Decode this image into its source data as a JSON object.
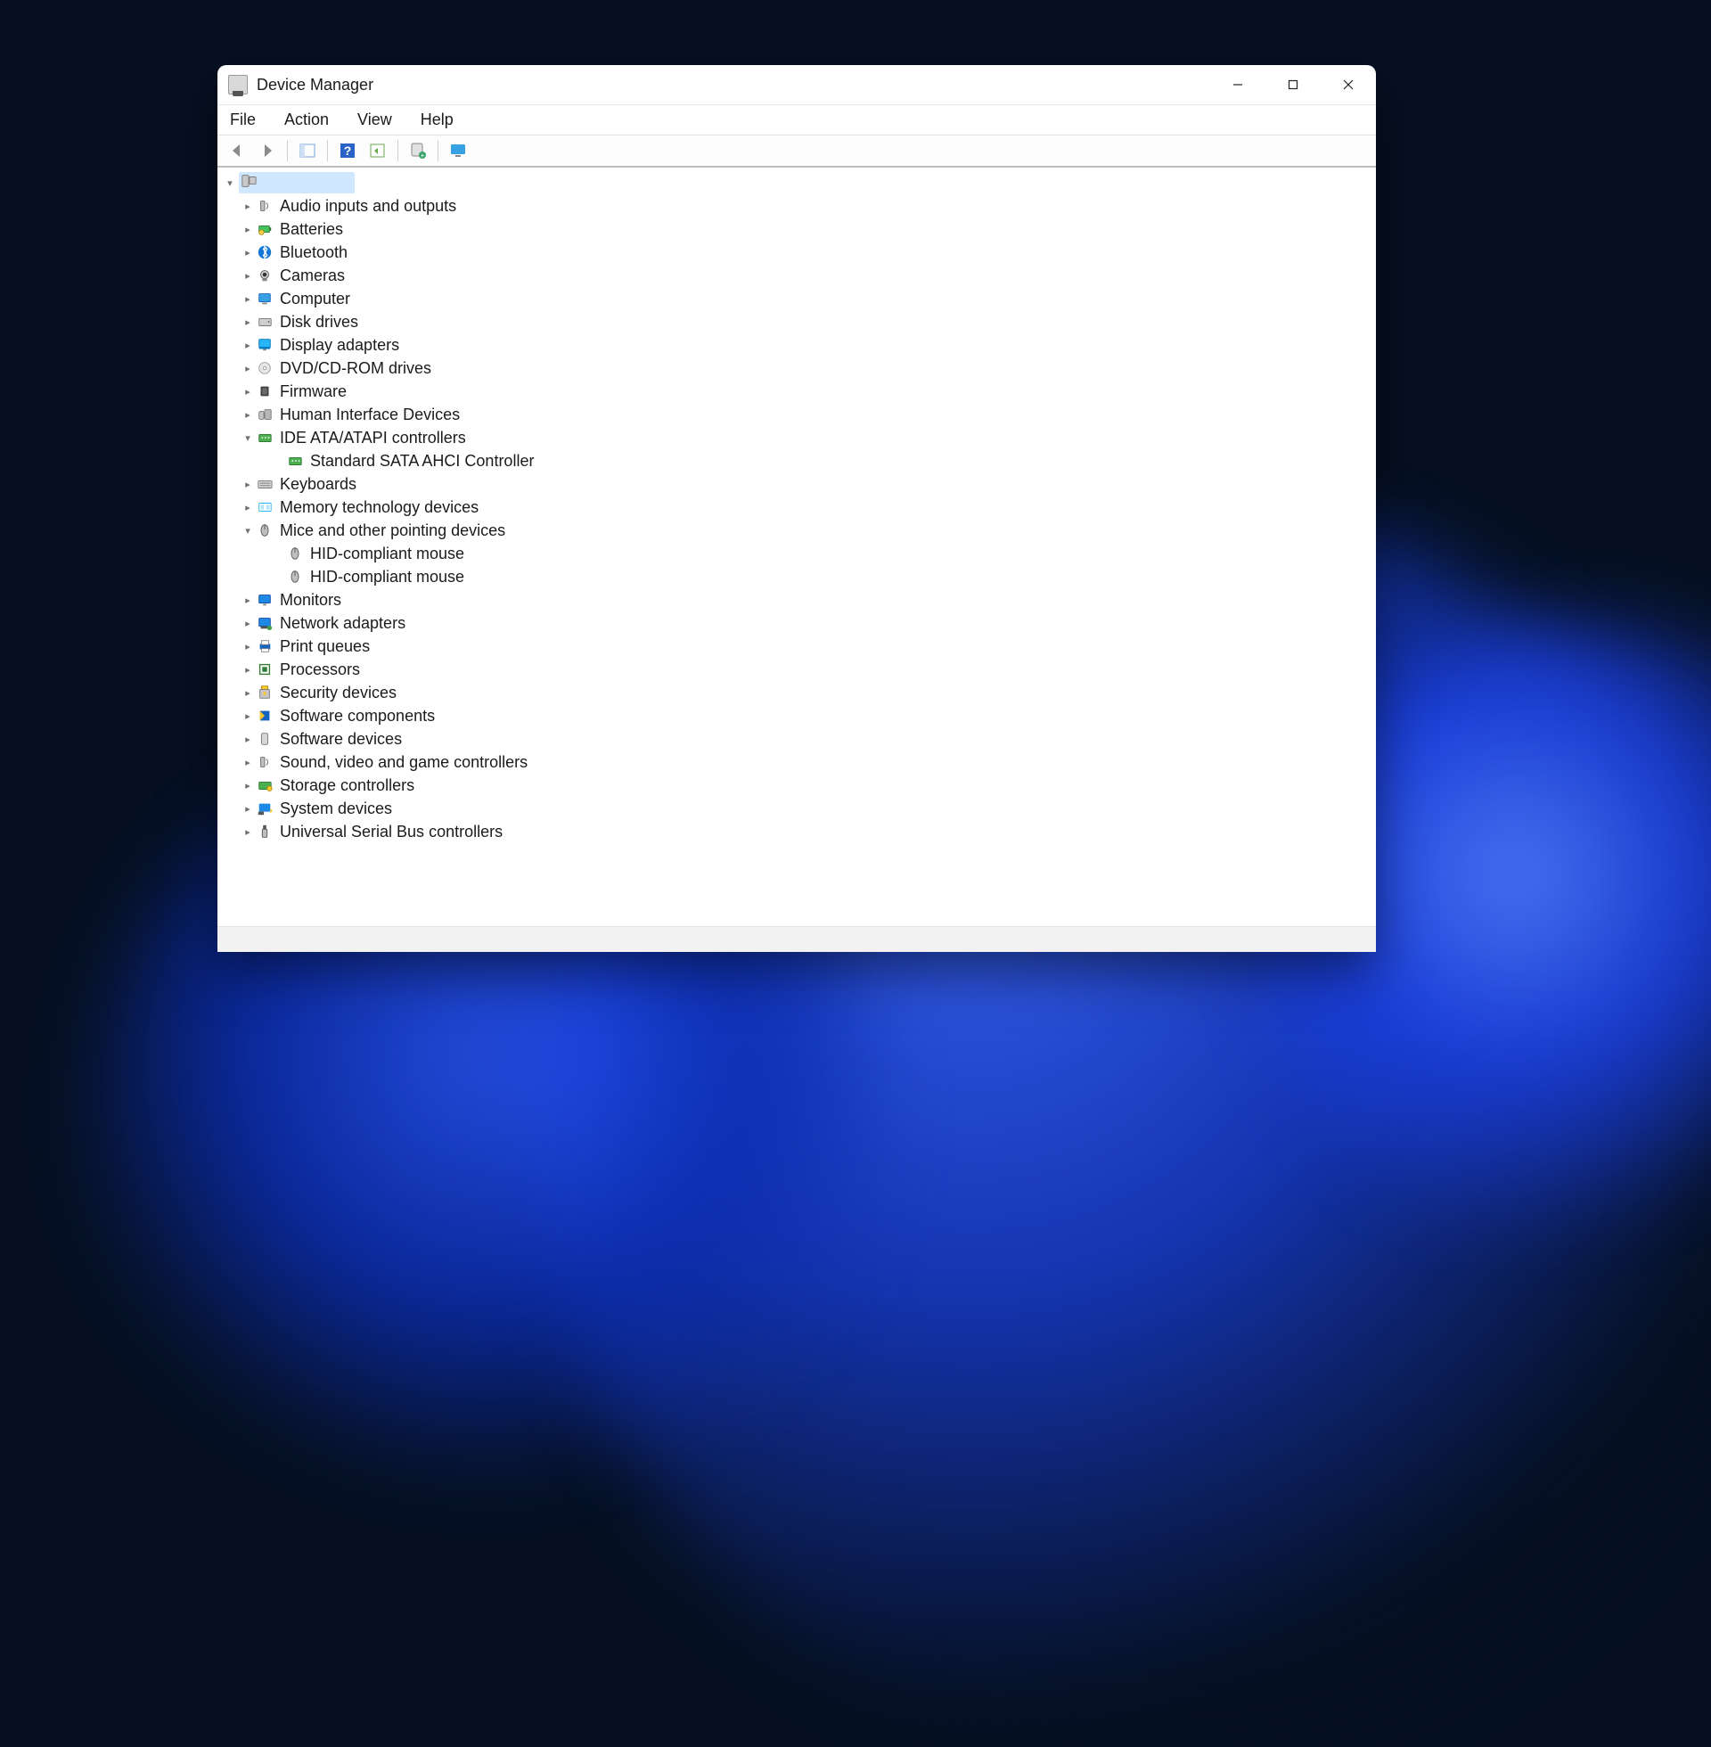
{
  "window": {
    "title": "Device Manager"
  },
  "menu": {
    "file": "File",
    "action": "Action",
    "view": "View",
    "help": "Help"
  },
  "toolbar": {
    "back": "Back",
    "forward": "Forward",
    "properties": "Properties",
    "help": "Help",
    "update": "Update",
    "scan": "Scan for hardware changes",
    "show": "Show hidden devices"
  },
  "tree": {
    "root": "",
    "items": [
      {
        "label": "Audio inputs and outputs",
        "icon": "speaker",
        "expanded": false
      },
      {
        "label": "Batteries",
        "icon": "battery",
        "expanded": false
      },
      {
        "label": "Bluetooth",
        "icon": "bluetooth",
        "expanded": false
      },
      {
        "label": "Cameras",
        "icon": "camera",
        "expanded": false
      },
      {
        "label": "Computer",
        "icon": "computer",
        "expanded": false
      },
      {
        "label": "Disk drives",
        "icon": "disk",
        "expanded": false
      },
      {
        "label": "Display adapters",
        "icon": "display",
        "expanded": false
      },
      {
        "label": "DVD/CD-ROM drives",
        "icon": "optical",
        "expanded": false
      },
      {
        "label": "Firmware",
        "icon": "chip",
        "expanded": false
      },
      {
        "label": "Human Interface Devices",
        "icon": "hid",
        "expanded": false
      },
      {
        "label": "IDE ATA/ATAPI controllers",
        "icon": "controller",
        "expanded": true,
        "children": [
          {
            "label": "Standard SATA AHCI Controller",
            "icon": "controller"
          }
        ]
      },
      {
        "label": "Keyboards",
        "icon": "keyboard",
        "expanded": false
      },
      {
        "label": "Memory technology devices",
        "icon": "memory",
        "expanded": false
      },
      {
        "label": "Mice and other pointing devices",
        "icon": "mouse",
        "expanded": true,
        "children": [
          {
            "label": "HID-compliant mouse",
            "icon": "mouse"
          },
          {
            "label": "HID-compliant mouse",
            "icon": "mouse"
          }
        ]
      },
      {
        "label": "Monitors",
        "icon": "monitor",
        "expanded": false
      },
      {
        "label": "Network adapters",
        "icon": "network",
        "expanded": false
      },
      {
        "label": "Print queues",
        "icon": "printer",
        "expanded": false
      },
      {
        "label": "Processors",
        "icon": "cpu",
        "expanded": false
      },
      {
        "label": "Security devices",
        "icon": "security",
        "expanded": false
      },
      {
        "label": "Software components",
        "icon": "component",
        "expanded": false
      },
      {
        "label": "Software devices",
        "icon": "swdevice",
        "expanded": false
      },
      {
        "label": "Sound, video and game controllers",
        "icon": "speaker",
        "expanded": false
      },
      {
        "label": "Storage controllers",
        "icon": "storage",
        "expanded": false
      },
      {
        "label": "System devices",
        "icon": "system",
        "expanded": false
      },
      {
        "label": "Universal Serial Bus controllers",
        "icon": "usb",
        "expanded": false
      }
    ]
  }
}
